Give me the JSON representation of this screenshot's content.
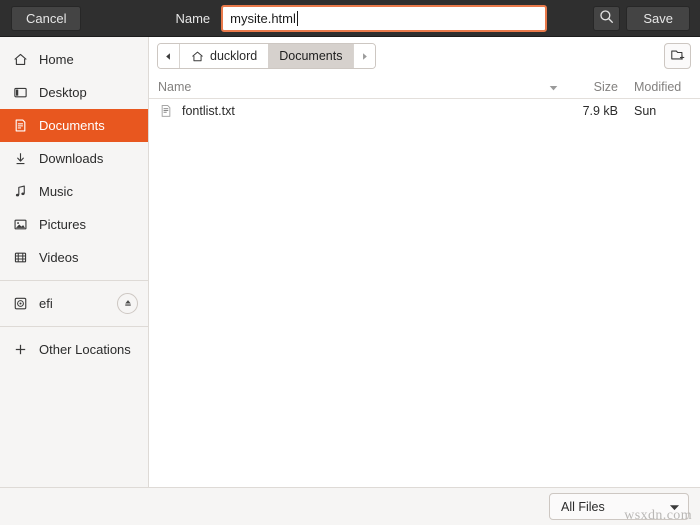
{
  "header": {
    "cancel_label": "Cancel",
    "name_label": "Name",
    "filename_value": "mysite.html",
    "filename_placeholder": "Name",
    "search_icon": "search-icon",
    "save_label": "Save"
  },
  "sidebar": {
    "items": [
      {
        "label": "Home",
        "icon": "home-icon",
        "selected": false
      },
      {
        "label": "Desktop",
        "icon": "desktop-icon",
        "selected": false
      },
      {
        "label": "Documents",
        "icon": "documents-icon",
        "selected": true
      },
      {
        "label": "Downloads",
        "icon": "download-icon",
        "selected": false
      },
      {
        "label": "Music",
        "icon": "music-note-icon",
        "selected": false
      },
      {
        "label": "Pictures",
        "icon": "picture-icon",
        "selected": false
      },
      {
        "label": "Videos",
        "icon": "film-icon",
        "selected": false
      }
    ],
    "devices": [
      {
        "label": "efi",
        "icon": "disc-icon",
        "eject_icon": "eject-icon"
      }
    ],
    "other_locations": {
      "label": "Other Locations",
      "icon": "plus-icon"
    }
  },
  "pathbar": {
    "back_icon": "triangle-left-icon",
    "forward_icon": "triangle-right-icon",
    "crumbs": [
      {
        "label": "ducklord",
        "icon": "home-icon",
        "active": false
      },
      {
        "label": "Documents",
        "icon": "",
        "active": true
      }
    ],
    "new_folder_icon": "new-folder-icon"
  },
  "columns": {
    "name": "Name",
    "size": "Size",
    "modified": "Modified",
    "sort_icon": "sort-descending-icon"
  },
  "files": [
    {
      "name": "fontlist.txt",
      "size": "7.9 kB",
      "modified": "Sun",
      "icon": "text-file-icon"
    }
  ],
  "footer": {
    "filter_label": "All Files",
    "filter_arrow_icon": "chevron-down-icon"
  },
  "watermark": {
    "text": "wsxdn.com"
  },
  "colors": {
    "accent": "#e8571f",
    "header_bg": "#2f2f2f",
    "sidebar_bg": "#f6f5f4",
    "input_focus_border": "#e9794a"
  }
}
